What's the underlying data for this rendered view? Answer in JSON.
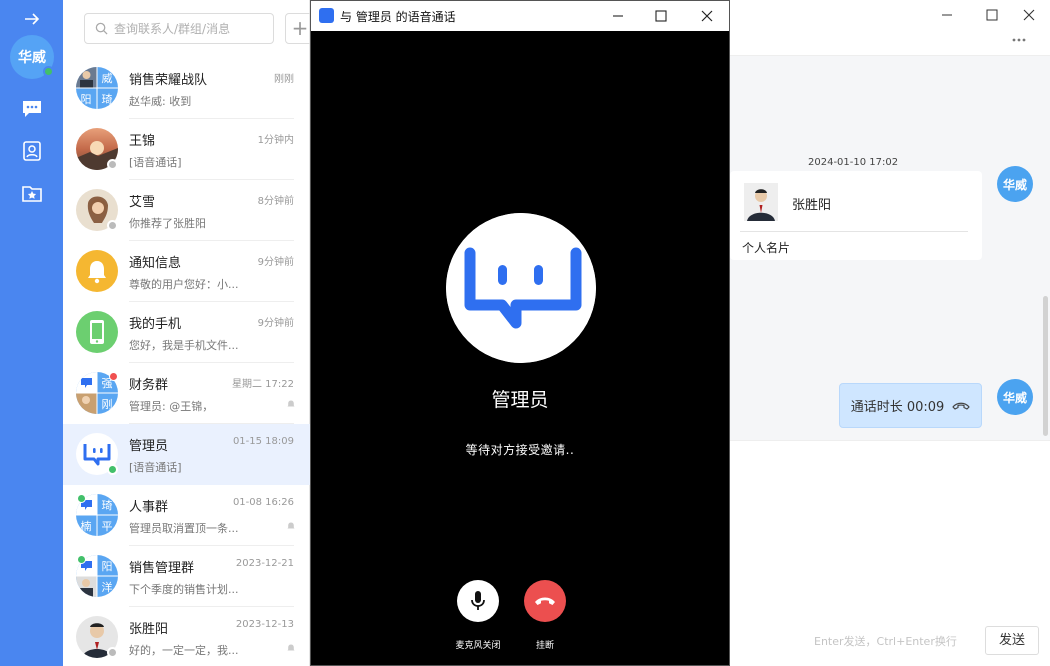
{
  "rail": {
    "user_avatar": "华威",
    "nav": [
      "chat-icon",
      "contacts-icon",
      "favorites-folder-icon"
    ],
    "accent": "#4a86f0"
  },
  "search": {
    "placeholder": "查询联系人/群组/消息"
  },
  "conversations": [
    {
      "name": "销售荣耀战队",
      "time": "刚刚",
      "msg": "赵华威: 收到",
      "avatar": "group"
    },
    {
      "name": "王锦",
      "time": "1分钟内",
      "msg": "[语音通话]",
      "avatar": "photo"
    },
    {
      "name": "艾雪",
      "time": "8分钟前",
      "msg": "你推荐了张胜阳",
      "avatar": "photo"
    },
    {
      "name": "通知信息",
      "time": "9分钟前",
      "msg": "尊敬的用户您好：小...",
      "avatar": "bell"
    },
    {
      "name": "我的手机",
      "time": "9分钟前",
      "msg": "您好，我是手机文件...",
      "avatar": "phone"
    },
    {
      "name": "财务群",
      "time": "星期二 17:22",
      "msg": "管理员: @王锦，",
      "avatar": "group"
    },
    {
      "name": "管理员",
      "time": "01-15 18:09",
      "msg": "[语音通话]",
      "avatar": "logo"
    },
    {
      "name": "人事群",
      "time": "01-08 16:26",
      "msg": "管理员取消置顶一条...",
      "avatar": "group"
    },
    {
      "name": "销售管理群",
      "time": "2023-12-21",
      "msg": "下个季度的销售计划...",
      "avatar": "group"
    },
    {
      "name": "张胜阳",
      "time": "2023-12-13",
      "msg": "好的，一定一定，我...",
      "avatar": "photo"
    }
  ],
  "group_avatars": {
    "sales": [
      "威",
      "阳",
      "琦"
    ],
    "finance": [
      "强",
      "刚"
    ],
    "hr": [
      "琦",
      "楠",
      "平"
    ],
    "salesmgmt": [
      "阳",
      "洋"
    ]
  },
  "chat": {
    "timestamp": "2024-01-10 17:02",
    "card_name": "张胜阳",
    "card_type": "个人名片",
    "call_bubble": "通话时长 00:09",
    "user_avatar": "华威",
    "input_hint": "Enter发送，Ctrl+Enter换行",
    "send": "发送"
  },
  "call_window": {
    "title": "与 管理员 的语音通话",
    "callee": "管理员",
    "status": "等待对方接受邀请..",
    "mic_label": "麦克风关闭",
    "hangup_label": "挂断"
  }
}
